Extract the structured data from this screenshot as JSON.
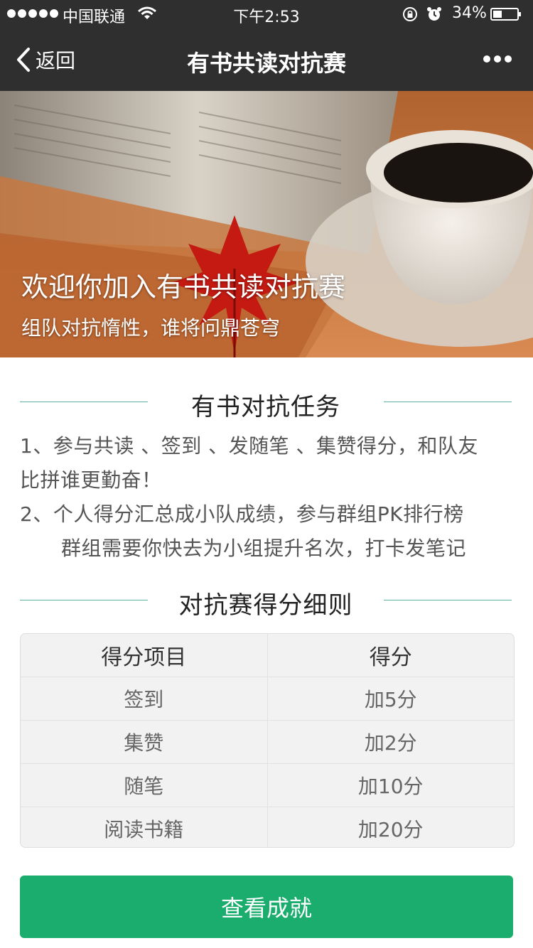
{
  "status_bar": {
    "carrier": "中国联通",
    "time": "下午2:53",
    "battery": "34%"
  },
  "nav": {
    "back_label": "返回",
    "title": "有书共读对抗赛"
  },
  "banner": {
    "title": "欢迎你加入有书共读对抗赛",
    "subtitle": "组队对抗惰性，谁将问鼎苍穹"
  },
  "tasks_section": {
    "heading": "有书对抗任务",
    "line1": "1、参与共读 、签到 、发随笔 、集赞得分，和队友",
    "line2": "比拼谁更勤奋！",
    "line3": "2、个人得分汇总成小队成绩，参与群组PK排行榜",
    "line4": "群组需要你快去为小组提升名次，打卡发笔记"
  },
  "rules_section": {
    "heading": "对抗赛得分细则",
    "columns": [
      "得分项目",
      "得分"
    ],
    "rows": [
      [
        "签到",
        "加5分"
      ],
      [
        "集赞",
        "加2分"
      ],
      [
        "随笔",
        "加10分"
      ],
      [
        "阅读书籍",
        "加20分"
      ]
    ]
  },
  "actions": {
    "view_achievements": "查看成就"
  },
  "colors": {
    "bar_bg": "#2f2f2f",
    "accent_line": "#5ab2a8",
    "button_green": "#1aad6e"
  }
}
